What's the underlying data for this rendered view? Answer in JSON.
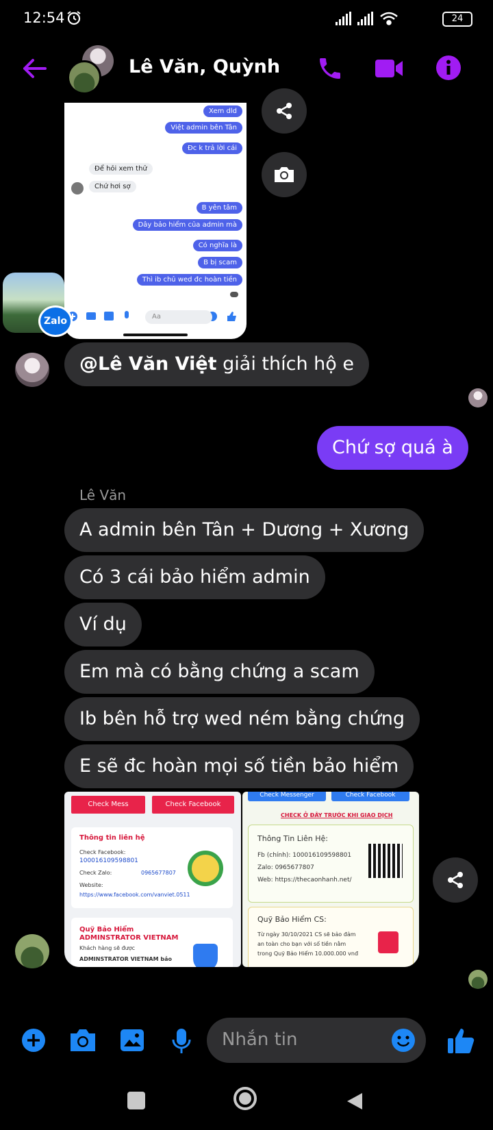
{
  "status_bar": {
    "time": "12:54",
    "battery": "24"
  },
  "header": {
    "title": "Lê Văn, Quỳnh"
  },
  "screenshot1": {
    "messages": [
      {
        "text": "Xem dld",
        "side": "sent"
      },
      {
        "text": "Việt admin bên Tân",
        "side": "sent"
      },
      {
        "text": "Đc k trả lời cái",
        "side": "sent"
      },
      {
        "text": "Để hỏi xem thử",
        "side": "recv"
      },
      {
        "text": "Chứ hơi sợ",
        "side": "recv"
      },
      {
        "text": "B yên tâm",
        "side": "sent"
      },
      {
        "text": "Dây bảo hiểm của admin mà",
        "side": "sent"
      },
      {
        "text": "Có nghĩa là",
        "side": "sent"
      },
      {
        "text": "B bị scam",
        "side": "sent"
      },
      {
        "text": "Thì ib chủ wed đc hoàn tiền",
        "side": "sent"
      }
    ],
    "input_placeholder": "Aa"
  },
  "zalo_badge": "Zalo",
  "messages": {
    "quynh_mention": "@Lê Văn Việt",
    "quynh_text": " giải thích hộ e",
    "sent": "Chứ sợ quá à",
    "sender_name": "Lê Văn",
    "le_van": [
      "A admin bên Tân + Dương + Xương",
      "Có 3 cái bảo hiểm admin",
      "Ví dụ",
      "Em mà có bằng chứng a scam",
      "Ib bên hỗ trợ wed ném bằng chứng",
      "E sẽ đc hoàn mọi số tiền bảo hiểm"
    ]
  },
  "image2a": {
    "btn_mess": "Check Mess",
    "btn_facebook": "Check Facebook",
    "contact_title": "Thông tin liên hệ",
    "fb_label": "Check Facebook:",
    "fb_value": "100016109598801",
    "zalo_label": "Check Zalo:",
    "zalo_value": "0965677807",
    "web_label": "Website:",
    "web_value": "https://www.facebook.com/vanviet.0511",
    "fund_title": "Quỹ Bảo Hiểm",
    "fund_sub": "ADMINSTRATOR VIETNAM",
    "fund_text1": "Khách hàng sẽ được",
    "fund_text2": "ADMINSTRATOR VIETNAM bảo"
  },
  "image2b": {
    "btn_messenger": "Check Messenger",
    "btn_facebook": "Check Facebook",
    "warning": "CHECK Ở ĐÂY TRƯỚC KHI GIAO DỊCH",
    "contact_title": "Thông Tin Liên Hệ:",
    "fb": "Fb (chính): 100016109598801",
    "zalo": "Zalo: 0965677807",
    "web": "Web: https://thecaonhanh.net/",
    "fund_title": "Quỹ Bảo Hiểm CS:",
    "fund_line1": "Từ ngày 30/10/2021 CS sẽ bảo đảm",
    "fund_line2": "an toàn cho bạn với số tiền nằm",
    "fund_line3": "trong Quỹ Bảo Hiểm 10.000.000 vnđ"
  },
  "composer": {
    "placeholder": "Nhắn tin"
  },
  "colors": {
    "accent": "#a11cf3",
    "sent_bubble": "#7a3cf5",
    "composer_icon": "#1d87f5"
  }
}
